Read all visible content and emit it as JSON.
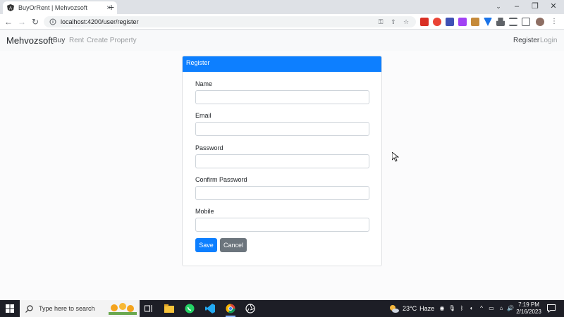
{
  "browser": {
    "tab_title": "BuyOrRent | Mehvozsoft",
    "tab_close": "×",
    "new_tab": "+",
    "url": "localhost:4200/user/register",
    "window_controls": {
      "minimize": "–",
      "restore": "❐",
      "close": "✕"
    }
  },
  "navbar": {
    "brand": "Mehvozsoft",
    "links": [
      {
        "label": "Buy"
      },
      {
        "label": "Rent"
      },
      {
        "label": "Create Property"
      }
    ],
    "right_links": [
      {
        "label": "Register"
      },
      {
        "label": "Login"
      }
    ]
  },
  "register_card": {
    "header": "Register",
    "fields": [
      {
        "label": "Name",
        "value": "",
        "placeholder": ""
      },
      {
        "label": "Email",
        "value": "",
        "placeholder": ""
      },
      {
        "label": "Password",
        "value": "",
        "placeholder": ""
      },
      {
        "label": "Confirm Password",
        "value": "",
        "placeholder": ""
      },
      {
        "label": "Mobile",
        "value": "",
        "placeholder": ""
      }
    ],
    "save_label": "Save",
    "cancel_label": "Cancel"
  },
  "taskbar": {
    "search_placeholder": "Type here to search",
    "weather_temp": "23°C",
    "weather_text": "Haze",
    "time": "7:19 PM",
    "date": "2/16/2023"
  },
  "colors": {
    "primary": "#0d7fff",
    "secondary": "#6c757d",
    "navbar_bg": "#f8f9fa",
    "taskbar_bg": "#1d1e26"
  }
}
